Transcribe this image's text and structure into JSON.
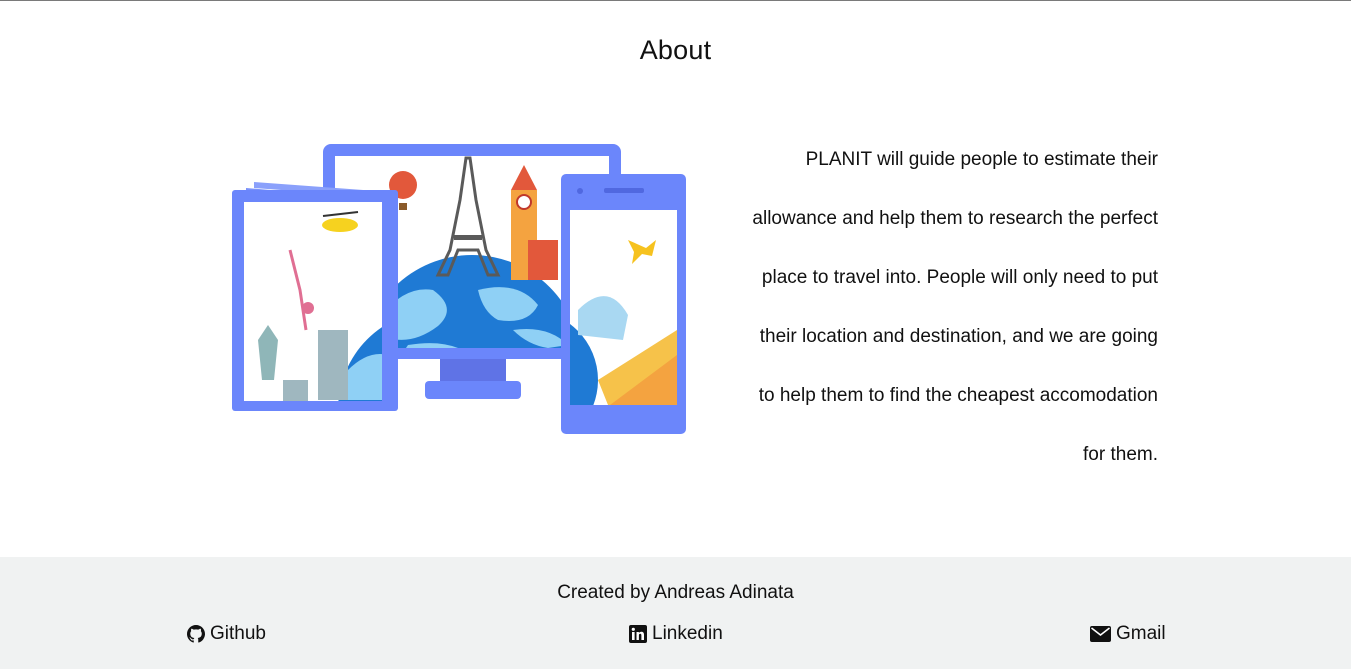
{
  "about": {
    "title": "About",
    "description": "PLANIT will guide people to estimate their allowance and help them to research the perfect place to travel into. People will only need to put their location and destination, and we are going to help them to find the cheapest accomodation for them.",
    "illustration": {
      "name": "travel-devices-illustration",
      "colors": {
        "device_frame": "#6b86fb",
        "globe": "#1f7ad4",
        "globe_land": "#8fd0f5",
        "accent_orange": "#f4a340",
        "accent_red": "#e2583b",
        "accent_yellow": "#f6d21f"
      }
    }
  },
  "footer": {
    "credit": "Created by Andreas Adinata",
    "background": "#f0f2f2",
    "links": {
      "github": {
        "label": "Github",
        "icon": "github-icon"
      },
      "linkedin": {
        "label": "Linkedin",
        "icon": "linkedin-icon"
      },
      "gmail": {
        "label": "Gmail",
        "icon": "envelope-icon"
      }
    }
  }
}
